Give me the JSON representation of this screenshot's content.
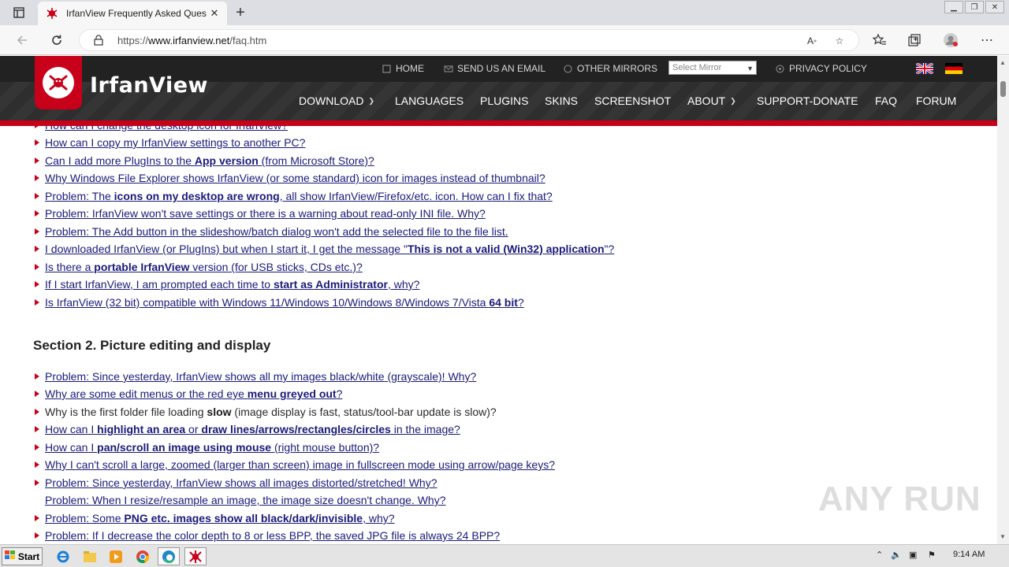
{
  "browser": {
    "tab_title": "IrfanView Frequently Asked Ques",
    "url_prefix": "https://",
    "url_domain": "www.irfanview.net",
    "url_path": "/faq.htm"
  },
  "site": {
    "logo_text": "IrfanView",
    "top_links": {
      "home": "HOME",
      "email": "SEND US AN EMAIL",
      "mirrors": "OTHER MIRRORS",
      "mirror_select": "Select Mirror",
      "privacy": "PRIVACY POLICY"
    },
    "nav": {
      "download": "DOWNLOAD",
      "languages": "LANGUAGES",
      "plugins": "PLUGINS",
      "skins": "SKINS",
      "screenshot": "SCREENSHOT",
      "about": "ABOUT",
      "support": "SUPPORT-DONATE",
      "faq": "FAQ",
      "forum": "FORUM"
    }
  },
  "faq": {
    "partial_item": "How can I change the desktop icon for IrfanView?",
    "items_s1": [
      {
        "a": "How can I copy my IrfanView settings to another PC?"
      },
      {
        "a": "Can I add more PlugIns to the ",
        "b": "App version",
        "c": " (from Microsoft Store)?"
      },
      {
        "a": "Why Windows File Explorer shows IrfanView (or some standard) icon for images instead of thumbnail?"
      },
      {
        "a": "Problem: The ",
        "b": "icons on my desktop are wrong",
        "c": ", all show IrfanView/Firefox/etc. icon. How can I fix that?"
      },
      {
        "a": "Problem: IrfanView won't save settings or there is a warning about read-only INI file. Why?"
      },
      {
        "a": "Problem: The Add button in the slideshow/batch dialog won't add the selected file to the file list."
      },
      {
        "a": "I downloaded IrfanView (or PlugIns) but when I start it, I get the message \"",
        "b": "This is not a valid (Win32) application",
        "c": "\"?"
      },
      {
        "a": "Is there a ",
        "b": "portable IrfanView",
        "c": " version (for USB sticks, CDs etc.)?"
      },
      {
        "a": "If I start IrfanView, I am prompted each time to ",
        "b": "start as Administrator",
        "c": ", why?"
      },
      {
        "a": "Is IrfanView (32 bit) compatible with Windows 11/Windows 10/Windows 8/Windows 7/Vista ",
        "b": "64 bit",
        "c": "?"
      }
    ],
    "section2_title": "Section 2. Picture editing and display",
    "s2_0": "Problem: Since yesterday, IrfanView shows all my images black/white (grayscale)! Why?",
    "s2_1": {
      "a": "Why are some edit menus or the red eye ",
      "b": "menu greyed out",
      "c": "?"
    },
    "s2_2": {
      "a": "Why is the first folder file loading ",
      "b": "slow",
      "c": " (image display is fast, status/tool-bar update is slow)?"
    },
    "s2_3": {
      "a": "How can I ",
      "b": "highlight an area",
      "c": " or ",
      "d": "draw lines/arrows/rectangles/circles",
      "e": " in the image?"
    },
    "s2_4": {
      "a": "How can I ",
      "b": "pan/scroll an image using mouse",
      "c": " (right mouse button)?"
    },
    "s2_5": "Why I can't scroll a large, zoomed (larger than screen) image in fullscreen mode using arrow/page keys?",
    "s2_6": "Problem: Since yesterday, IrfanView shows all images distorted/stretched! Why?",
    "s2_7": "Problem: When I resize/resample an image, the image size doesn't change. Why?",
    "s2_8": {
      "a": "Problem: Some ",
      "b": "PNG etc. images show all black/dark/invisible",
      "c": ", why?"
    },
    "s2_9": "Problem: If I decrease the color depth to 8 or less BPP, the saved JPG file is always 24 BPP?"
  },
  "watermark": "ANY RUN",
  "taskbar": {
    "start": "Start",
    "clock": "9:14 AM"
  }
}
